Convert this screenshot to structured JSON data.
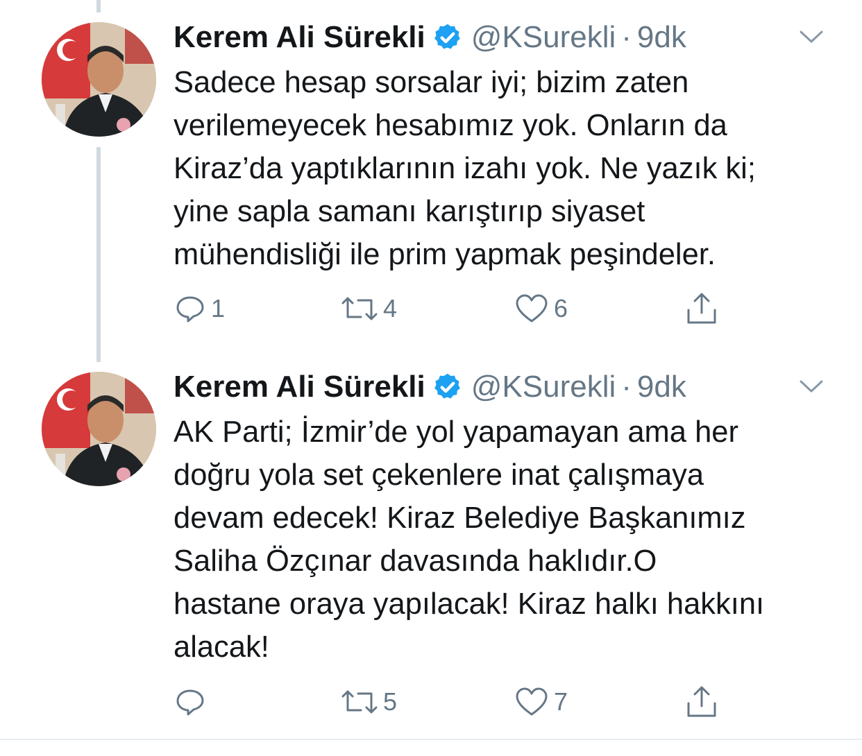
{
  "tweets": [
    {
      "author": {
        "name": "Kerem Ali Sürekli",
        "handle": "@KSurekli",
        "separator": "·",
        "time": "9dk",
        "verified": true
      },
      "text_lines": [
        "Sadece hesap sorsalar iyi; bizim zaten",
        "verilemeyecek hesabımız yok. Onların da",
        "Kiraz’da yaptıklarının izahı yok. Ne yazık ki;",
        "yine sapla samanı karıştırıp siyaset",
        "mühendisliği ile prim yapmak peşindeler."
      ],
      "actions": {
        "reply_count": "1",
        "retweet_count": "4",
        "like_count": "6",
        "share_icon": "share-icon"
      }
    },
    {
      "author": {
        "name": "Kerem Ali Sürekli",
        "handle": "@KSurekli",
        "separator": "·",
        "time": "9dk",
        "verified": true
      },
      "text_lines": [
        "AK Parti; İzmir’de yol yapamayan ama her",
        "doğru yola set çekenlere inat çalışmaya",
        "devam edecek! Kiraz Belediye Başkanımız",
        "Saliha Özçınar davasında haklıdır.O",
        "hastane oraya yapılacak! Kiraz halkı hakkını",
        "alacak!"
      ],
      "actions": {
        "reply_count": "",
        "retweet_count": "5",
        "like_count": "7",
        "share_icon": "share-icon"
      }
    }
  ],
  "colors": {
    "verified_blue": "#1da1f2",
    "text_primary": "#14171a",
    "text_secondary": "#657786",
    "thread_line": "#cfd9de"
  }
}
